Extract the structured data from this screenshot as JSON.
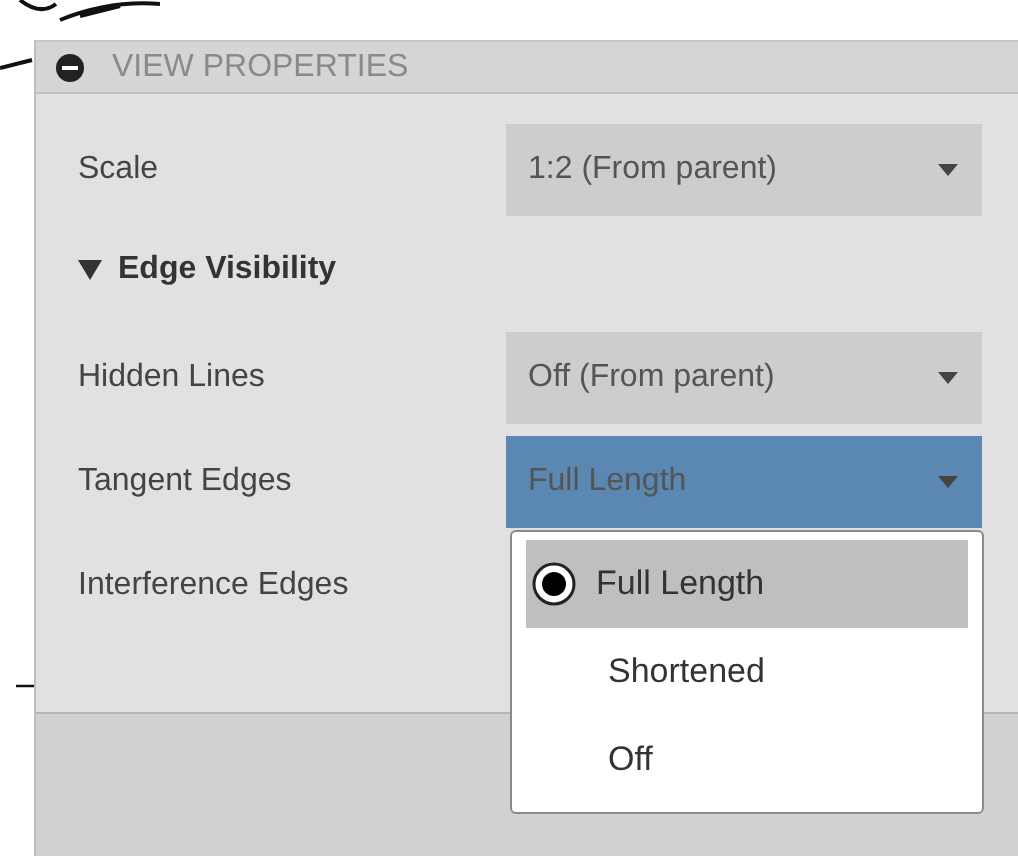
{
  "panel": {
    "title": "VIEW PROPERTIES",
    "expanded": true
  },
  "rows": [
    {
      "kind": "dropdown",
      "label": "Scale",
      "value": "1:2 (From parent)",
      "focused": false
    },
    {
      "kind": "section",
      "label": "Edge Visibility",
      "expanded": true
    },
    {
      "kind": "dropdown",
      "label": "Hidden Lines",
      "value": "Off (From parent)",
      "focused": false
    },
    {
      "kind": "dropdown",
      "label": "Tangent Edges",
      "value": "Full Length",
      "focused": true,
      "options": [
        {
          "label": "Full Length",
          "selected": true
        },
        {
          "label": "Shortened",
          "selected": false
        },
        {
          "label": "Off",
          "selected": false
        }
      ]
    },
    {
      "kind": "label",
      "label": "Interference Edges"
    }
  ]
}
